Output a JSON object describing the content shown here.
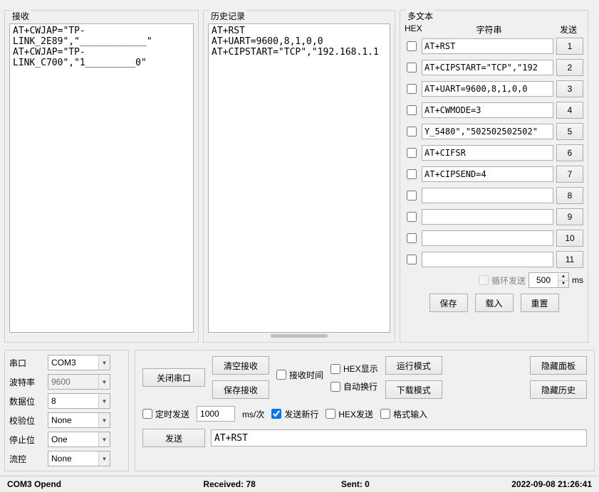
{
  "panels": {
    "receive_title": "接收",
    "history_title": "历史记录",
    "multi_title": "多文本",
    "multi_hex": "HEX",
    "multi_string": "字符串",
    "multi_send": "发送"
  },
  "receive_text": "AT+CWJAP=\"TP-\nLINK_2E89\",\"____________\"\nAT+CWJAP=\"TP-\nLINK_C700\",\"1_________0\"",
  "history_text": "AT+RST\nAT+UART=9600,8,1,0,0\nAT+CIPSTART=\"TCP\",\"192.168.1.1",
  "multi": {
    "rows": [
      {
        "checked": false,
        "text": "AT+RST",
        "num": "1"
      },
      {
        "checked": false,
        "text": "AT+CIPSTART=\"TCP\",\"192",
        "num": "2"
      },
      {
        "checked": false,
        "text": "AT+UART=9600,8,1,0,0",
        "num": "3"
      },
      {
        "checked": false,
        "text": "AT+CWMODE=3",
        "num": "4"
      },
      {
        "checked": false,
        "text": "Y_5480\",\"502502502502\"",
        "num": "5"
      },
      {
        "checked": false,
        "text": "AT+CIFSR",
        "num": "6"
      },
      {
        "checked": false,
        "text": "AT+CIPSEND=4",
        "num": "7"
      },
      {
        "checked": false,
        "text": "",
        "num": "8"
      },
      {
        "checked": false,
        "text": "",
        "num": "9"
      },
      {
        "checked": false,
        "text": "",
        "num": "10"
      },
      {
        "checked": false,
        "text": "",
        "num": "11"
      }
    ],
    "loop_label": "循环发送",
    "loop_value": "500",
    "loop_unit": "ms",
    "save": "保存",
    "load": "载入",
    "reset": "重置"
  },
  "port": {
    "port_label": "串口",
    "port_value": "COM3",
    "baud_label": "波特率",
    "baud_value": "9600",
    "databits_label": "数据位",
    "databits_value": "8",
    "parity_label": "校验位",
    "parity_value": "None",
    "stopbits_label": "停止位",
    "stopbits_value": "One",
    "flow_label": "流控",
    "flow_value": "None"
  },
  "config": {
    "close_port": "关闭串口",
    "clear_recv": "清空接收",
    "save_recv": "保存接收",
    "recv_time": "接收时间",
    "hex_display": "HEX显示",
    "auto_wrap": "自动换行",
    "run_mode": "运行模式",
    "download_mode": "下载模式",
    "hide_panel": "隐藏面板",
    "hide_history": "隐藏历史",
    "timed_send": "定时发送",
    "timed_value": "1000",
    "timed_unit": "ms/次",
    "send_newline": "发送新行",
    "hex_send": "HEX发送",
    "format_input": "格式输入",
    "send_btn": "发送",
    "send_text": "AT+RST"
  },
  "status": {
    "left": "COM3 Opend",
    "recv": "Received: 78",
    "sent": "Sent: 0",
    "time": "2022-09-08 21:26:41"
  }
}
